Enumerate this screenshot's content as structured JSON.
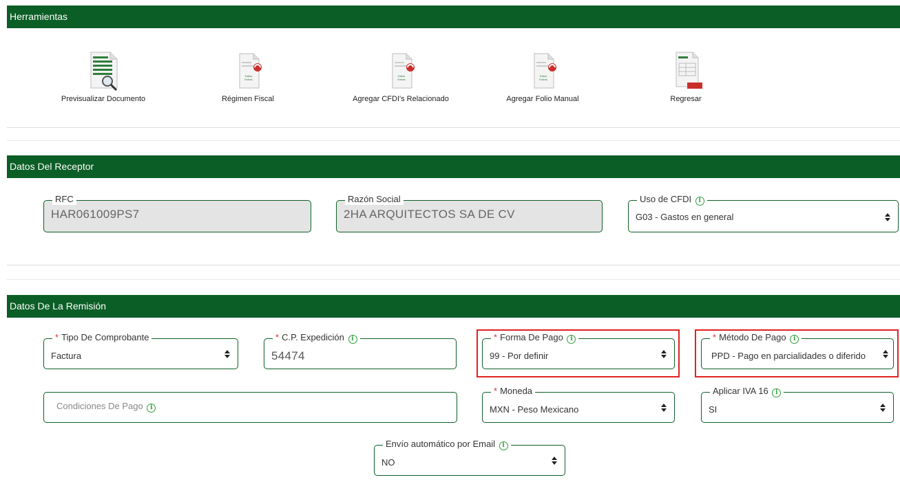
{
  "sections": {
    "tools": "Herramientas",
    "receptor": "Datos Del Receptor",
    "remision": "Datos De La Remisión"
  },
  "toolbar": {
    "preview": "Previsualizar Documento",
    "regimen": "Régimen Fiscal",
    "cfdi_rel": "Agregar CFDI's Relacionado",
    "folio": "Agregar Folio Manual",
    "back": "Regresar",
    "icon_text_1": "Datos",
    "icon_text_2": "Extras"
  },
  "receptor": {
    "rfc_label": "RFC",
    "rfc_value": "HAR061009PS7",
    "razon_label": "Razón Social",
    "razon_value": "2HA ARQUITECTOS SA DE CV",
    "uso_label": "Uso de CFDI",
    "uso_value": "G03 - Gastos en general"
  },
  "remision": {
    "tipo_label": "Tipo De Comprobante",
    "tipo_value": "Factura",
    "cp_label": "C.P. Expedición",
    "cp_value": "54474",
    "forma_label": "Forma De Pago",
    "forma_value": "99 - Por definir",
    "metodo_label": "Método De Pago",
    "metodo_value": "PPD - Pago en parcialidades o diferido",
    "condiciones_placeholder": "Condiciones De Pago",
    "moneda_label": "Moneda",
    "moneda_value": "MXN - Peso Mexicano",
    "iva_label": "Aplicar IVA 16",
    "iva_value": "SI",
    "email_label": "Envío automático por Email",
    "email_value": "NO"
  },
  "symbols": {
    "required": "*",
    "info": "i"
  },
  "colors": {
    "header_green": "#0b5e26",
    "highlight_red": "#e02020",
    "info_green": "#2e9e3a"
  }
}
